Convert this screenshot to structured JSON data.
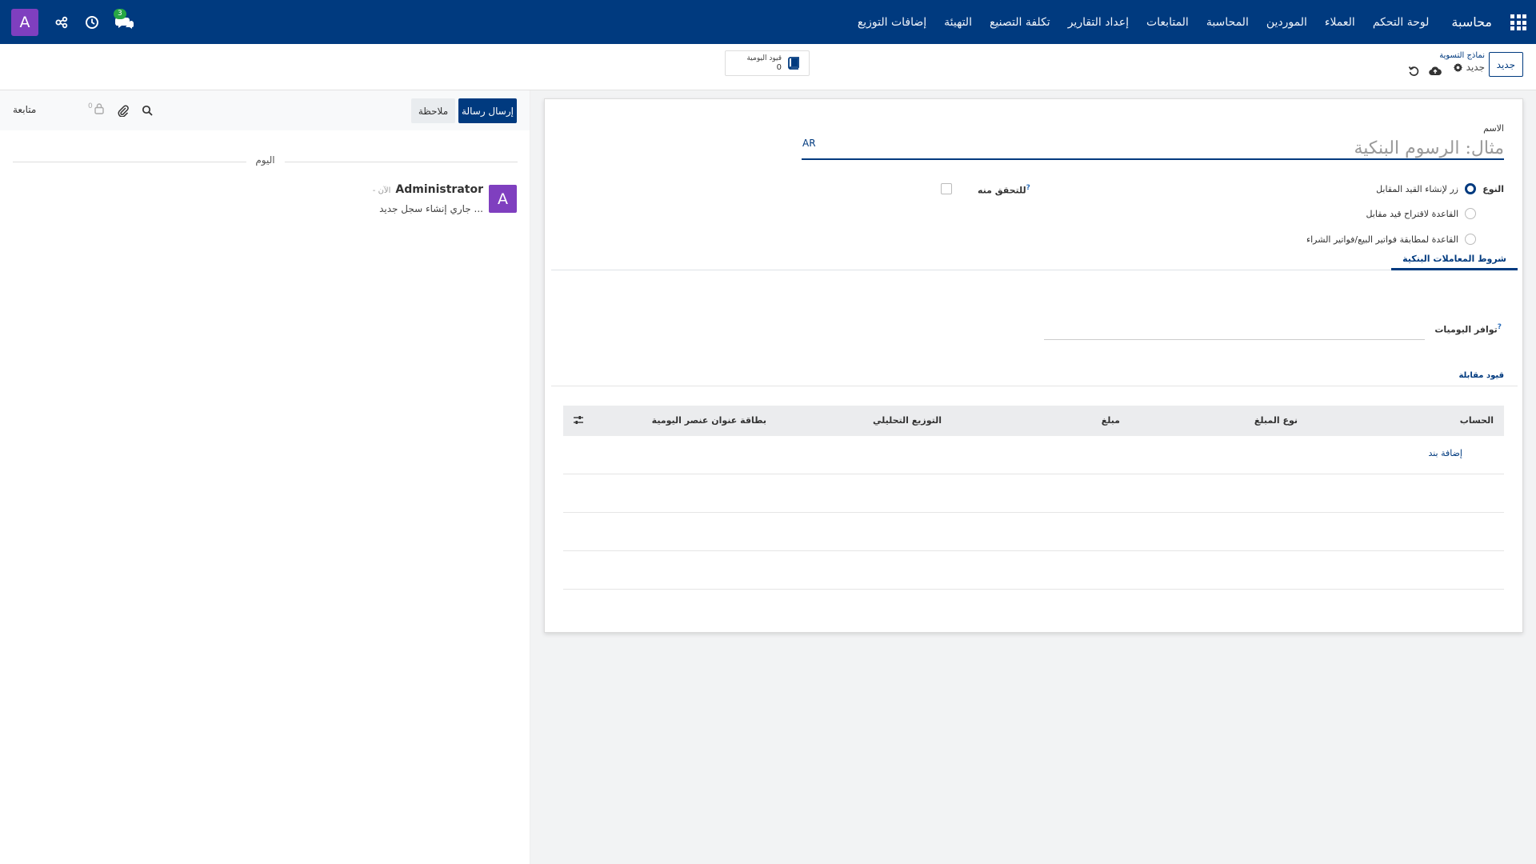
{
  "navbar": {
    "brand": "محاسبة",
    "menu": [
      "لوحة التحكم",
      "العملاء",
      "الموردين",
      "المحاسبة",
      "المتابعات",
      "إعداد التقارير",
      "تكلفة التصنيع",
      "التهيئة",
      "إضافات التوزيع"
    ],
    "user_initial": "A",
    "chat_badge": "3"
  },
  "control_panel": {
    "new_button": "جديد",
    "breadcrumb_parent": "نماذج التسوية",
    "breadcrumb_current": "جديد",
    "stat_label": "قيود اليومية",
    "stat_value": "0"
  },
  "chatter": {
    "send_message": "إرسال رسالة",
    "log_note": "ملاحظة",
    "follow": "متابعة",
    "follower_count": "0",
    "day_separator": "اليوم",
    "message": {
      "avatar_initial": "A",
      "author": "Administrator",
      "time": "- الآن",
      "body": "جاري إنشاء سجل جديد ..."
    }
  },
  "form": {
    "name_label": "الاسم",
    "name_placeholder": "مثال: الرسوم البنكية",
    "lang": "AR",
    "type_label": "النوع",
    "type_options": [
      {
        "label": "زر لإنشاء القيد المقابل",
        "checked": true
      },
      {
        "label": "القاعدة لاقتراح قيد مقابل",
        "checked": false
      },
      {
        "label": "القاعدة لمطابقة فواتير البيع/فواتير الشراء",
        "checked": false
      }
    ],
    "verify_label": "للتحقق منه",
    "help_mark": "?",
    "tab": "شروط المعاملات البنكية",
    "journals_label": "توافر اليوميات",
    "section_title": "قيود مقابلة",
    "table": {
      "columns": [
        "الحساب",
        "نوع المبلغ",
        "مبلغ",
        "التوزيع التحليلي",
        "بطاقة عنوان عنصر اليومية"
      ],
      "add_line": "إضافة بند"
    }
  }
}
